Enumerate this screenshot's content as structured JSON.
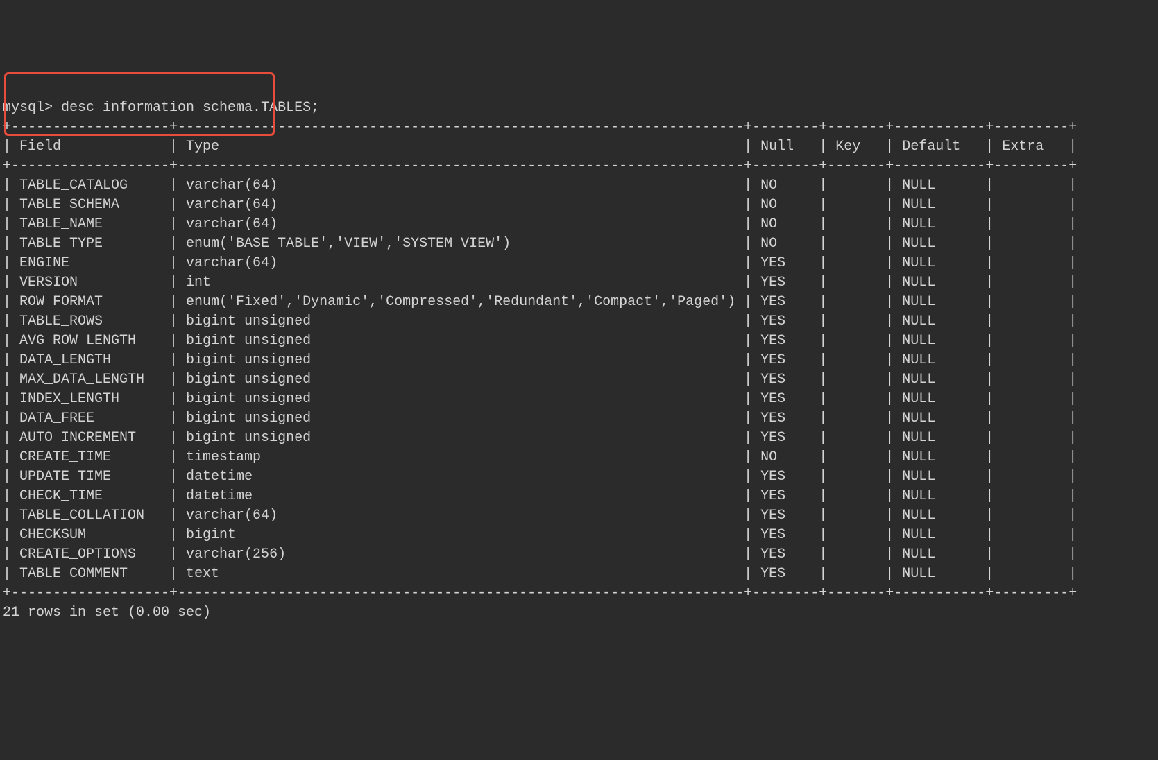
{
  "command": {
    "prompt": "mysql> ",
    "query": "desc information_schema.TABLES;"
  },
  "table": {
    "headers": [
      "Field",
      "Type",
      "Null",
      "Key",
      "Default",
      "Extra"
    ],
    "rows": [
      {
        "field": "TABLE_CATALOG",
        "type": "varchar(64)",
        "null": "NO",
        "key": "",
        "default": "NULL",
        "extra": ""
      },
      {
        "field": "TABLE_SCHEMA",
        "type": "varchar(64)",
        "null": "NO",
        "key": "",
        "default": "NULL",
        "extra": ""
      },
      {
        "field": "TABLE_NAME",
        "type": "varchar(64)",
        "null": "NO",
        "key": "",
        "default": "NULL",
        "extra": ""
      },
      {
        "field": "TABLE_TYPE",
        "type": "enum('BASE TABLE','VIEW','SYSTEM VIEW')",
        "null": "NO",
        "key": "",
        "default": "NULL",
        "extra": ""
      },
      {
        "field": "ENGINE",
        "type": "varchar(64)",
        "null": "YES",
        "key": "",
        "default": "NULL",
        "extra": ""
      },
      {
        "field": "VERSION",
        "type": "int",
        "null": "YES",
        "key": "",
        "default": "NULL",
        "extra": ""
      },
      {
        "field": "ROW_FORMAT",
        "type": "enum('Fixed','Dynamic','Compressed','Redundant','Compact','Paged')",
        "null": "YES",
        "key": "",
        "default": "NULL",
        "extra": ""
      },
      {
        "field": "TABLE_ROWS",
        "type": "bigint unsigned",
        "null": "YES",
        "key": "",
        "default": "NULL",
        "extra": ""
      },
      {
        "field": "AVG_ROW_LENGTH",
        "type": "bigint unsigned",
        "null": "YES",
        "key": "",
        "default": "NULL",
        "extra": ""
      },
      {
        "field": "DATA_LENGTH",
        "type": "bigint unsigned",
        "null": "YES",
        "key": "",
        "default": "NULL",
        "extra": ""
      },
      {
        "field": "MAX_DATA_LENGTH",
        "type": "bigint unsigned",
        "null": "YES",
        "key": "",
        "default": "NULL",
        "extra": ""
      },
      {
        "field": "INDEX_LENGTH",
        "type": "bigint unsigned",
        "null": "YES",
        "key": "",
        "default": "NULL",
        "extra": ""
      },
      {
        "field": "DATA_FREE",
        "type": "bigint unsigned",
        "null": "YES",
        "key": "",
        "default": "NULL",
        "extra": ""
      },
      {
        "field": "AUTO_INCREMENT",
        "type": "bigint unsigned",
        "null": "YES",
        "key": "",
        "default": "NULL",
        "extra": ""
      },
      {
        "field": "CREATE_TIME",
        "type": "timestamp",
        "null": "NO",
        "key": "",
        "default": "NULL",
        "extra": ""
      },
      {
        "field": "UPDATE_TIME",
        "type": "datetime",
        "null": "YES",
        "key": "",
        "default": "NULL",
        "extra": ""
      },
      {
        "field": "CHECK_TIME",
        "type": "datetime",
        "null": "YES",
        "key": "",
        "default": "NULL",
        "extra": ""
      },
      {
        "field": "TABLE_COLLATION",
        "type": "varchar(64)",
        "null": "YES",
        "key": "",
        "default": "NULL",
        "extra": ""
      },
      {
        "field": "CHECKSUM",
        "type": "bigint",
        "null": "YES",
        "key": "",
        "default": "NULL",
        "extra": ""
      },
      {
        "field": "CREATE_OPTIONS",
        "type": "varchar(256)",
        "null": "YES",
        "key": "",
        "default": "NULL",
        "extra": ""
      },
      {
        "field": "TABLE_COMMENT",
        "type": "text",
        "null": "YES",
        "key": "",
        "default": "NULL",
        "extra": ""
      }
    ]
  },
  "result": "21 rows in set (0.00 sec)",
  "column_widths": {
    "field": 17,
    "type": 66,
    "null": 6,
    "key": 5,
    "default": 9,
    "extra": 7
  }
}
